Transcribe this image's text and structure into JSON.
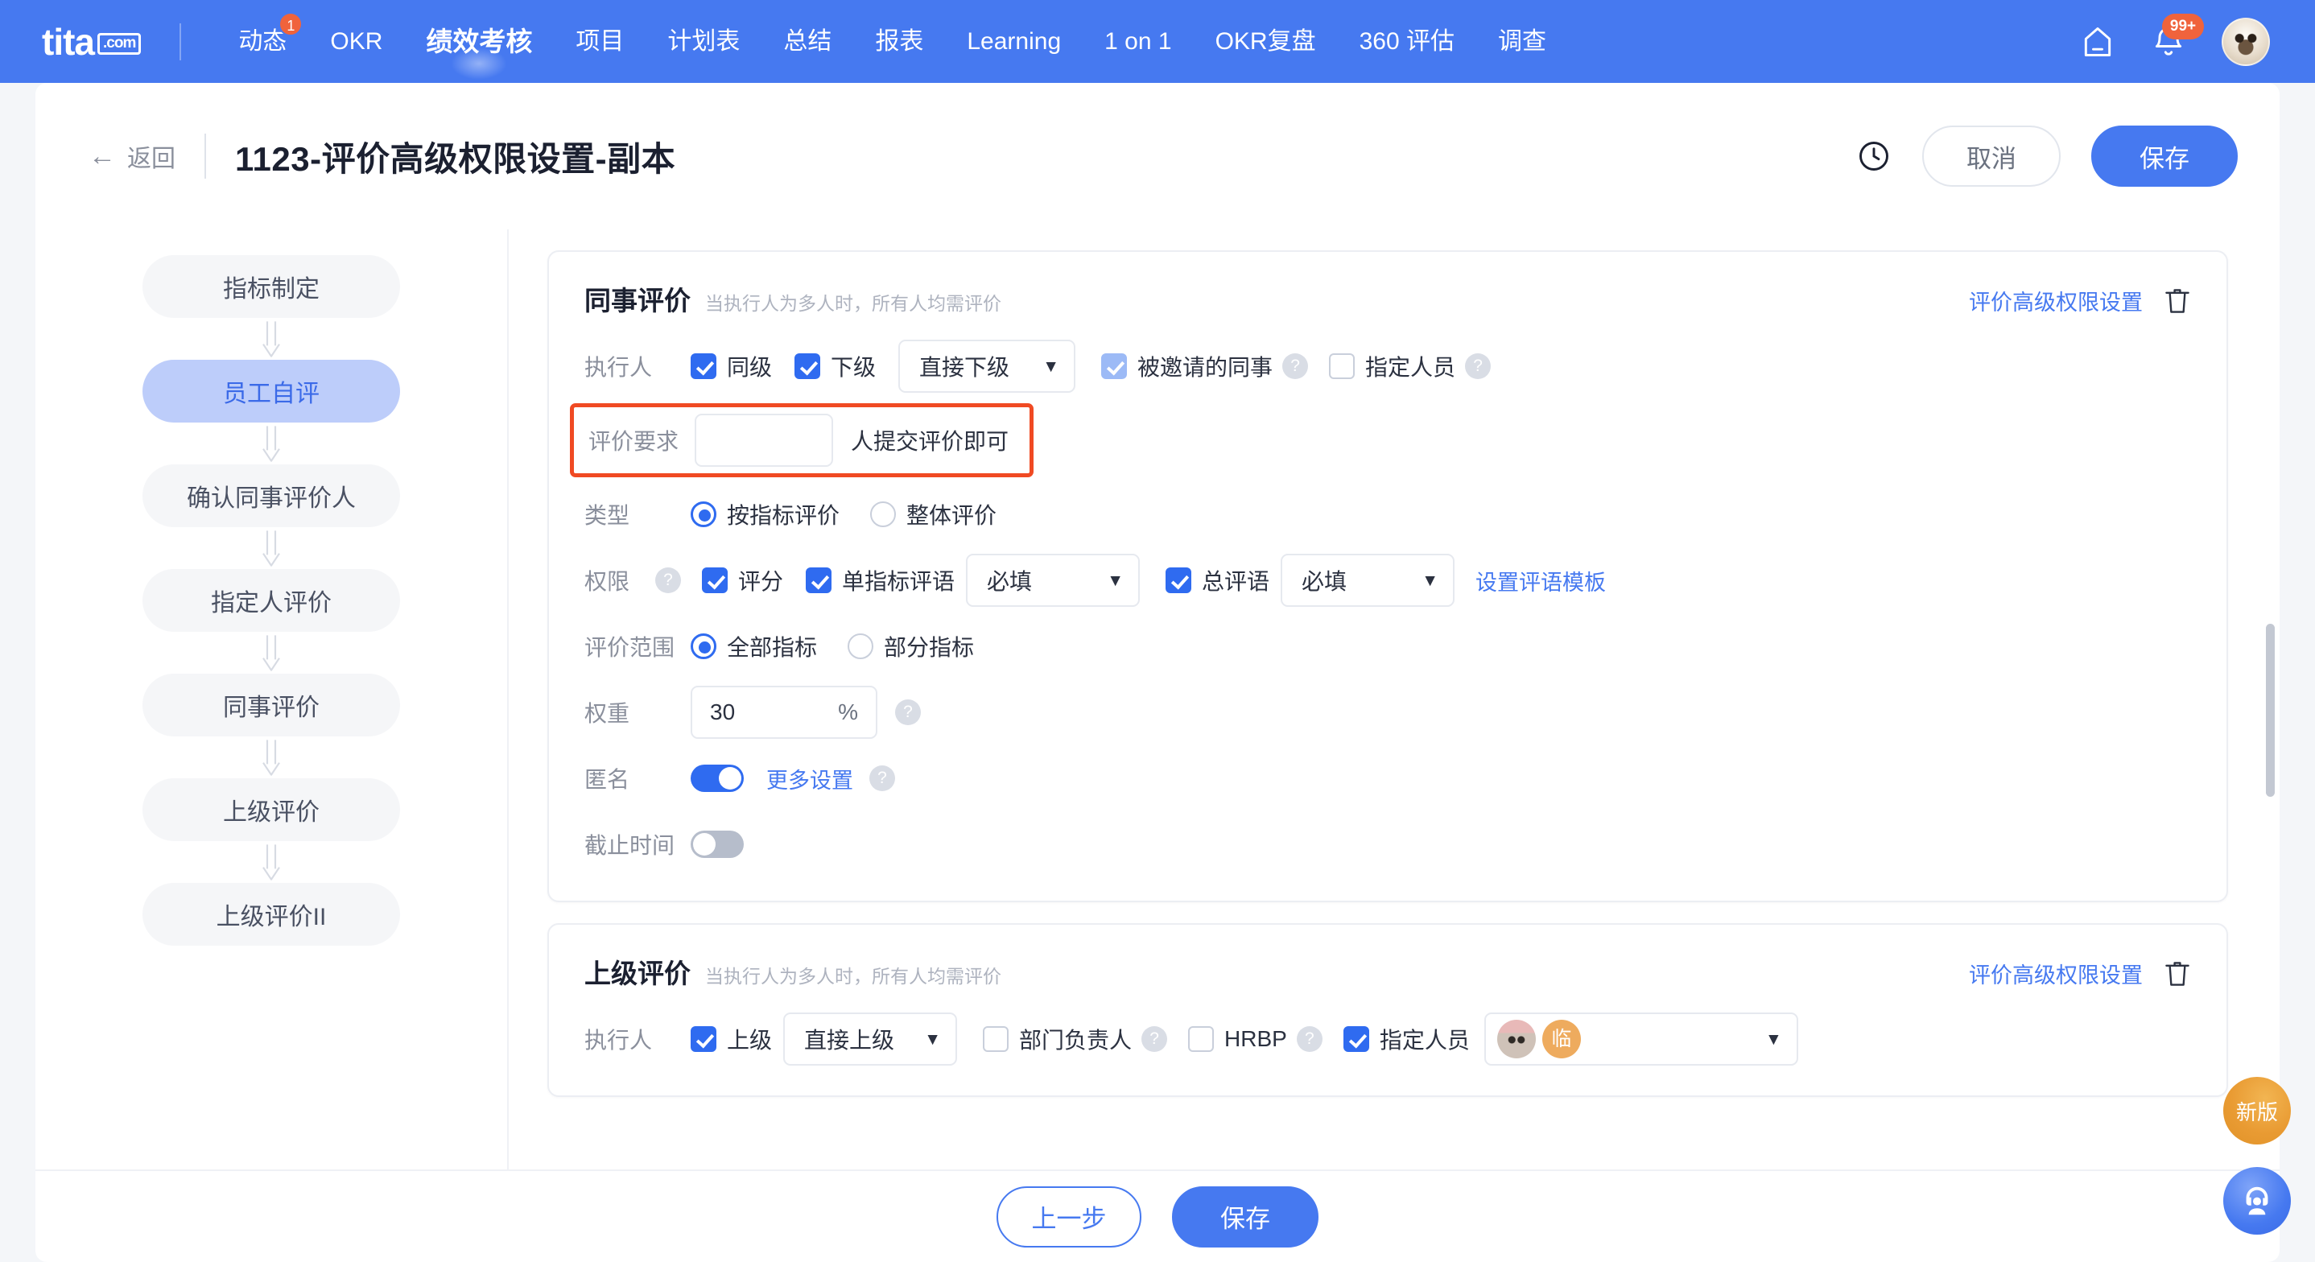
{
  "nav": {
    "logo": "tita",
    "logo_suffix": ".com",
    "items": [
      {
        "label": "动态",
        "badge": "1",
        "active": false
      },
      {
        "label": "OKR",
        "active": false
      },
      {
        "label": "绩效考核",
        "active": true
      },
      {
        "label": "项目",
        "active": false
      },
      {
        "label": "计划表",
        "active": false
      },
      {
        "label": "总结",
        "active": false
      },
      {
        "label": "报表",
        "active": false
      },
      {
        "label": "Learning",
        "active": false
      },
      {
        "label": "1 on 1",
        "active": false
      },
      {
        "label": "OKR复盘",
        "active": false
      },
      {
        "label": "360 评估",
        "active": false
      },
      {
        "label": "调查",
        "active": false
      }
    ],
    "notification_badge": "99+",
    "accent": "#4679f0"
  },
  "header": {
    "back_label": "返回",
    "title": "1123-评价高级权限设置-副本",
    "cancel_label": "取消",
    "save_label": "保存"
  },
  "stepper": {
    "steps": [
      {
        "label": "指标制定",
        "active": false
      },
      {
        "label": "员工自评",
        "active": true
      },
      {
        "label": "确认同事评价人",
        "active": false
      },
      {
        "label": "指定人评价",
        "active": false
      },
      {
        "label": "同事评价",
        "active": false
      },
      {
        "label": "上级评价",
        "active": false
      },
      {
        "label": "上级评价II",
        "active": false
      }
    ]
  },
  "card1": {
    "title": "同事评价",
    "subtitle": "当执行人为多人时，所有人均需评价",
    "advanced_link": "评价高级权限设置",
    "executor": {
      "label": "执行人",
      "cb_peer": "同级",
      "cb_sub": "下级",
      "select_value": "直接下级",
      "cb_invited": "被邀请的同事",
      "cb_specified": "指定人员"
    },
    "requirement": {
      "label": "评价要求",
      "input_value": "",
      "suffix": "人提交评价即可"
    },
    "type": {
      "label": "类型",
      "opt_by_metric": "按指标评价",
      "opt_overall": "整体评价"
    },
    "permission": {
      "label": "权限",
      "cb_score": "评分",
      "cb_metric_comment": "单指标评语",
      "sel_metric_comment": "必填",
      "cb_total_comment": "总评语",
      "sel_total_comment": "必填",
      "template_link": "设置评语模板"
    },
    "scope": {
      "label": "评价范围",
      "opt_all": "全部指标",
      "opt_partial": "部分指标"
    },
    "weight": {
      "label": "权重",
      "value": "30",
      "unit": "%"
    },
    "anonymous": {
      "label": "匿名",
      "more_link": "更多设置"
    },
    "deadline": {
      "label": "截止时间"
    }
  },
  "card2": {
    "title": "上级评价",
    "subtitle": "当执行人为多人时，所有人均需评价",
    "advanced_link": "评价高级权限设置",
    "executor": {
      "label": "执行人",
      "cb_superior": "上级",
      "select_value": "直接上级",
      "cb_dept_head": "部门负责人",
      "cb_hrbp": "HRBP",
      "cb_specified": "指定人员",
      "chip_label": "临"
    }
  },
  "footer": {
    "prev_label": "上一步",
    "save_label": "保存"
  },
  "floating": {
    "new_version": "新版"
  },
  "help_glyph": "?"
}
